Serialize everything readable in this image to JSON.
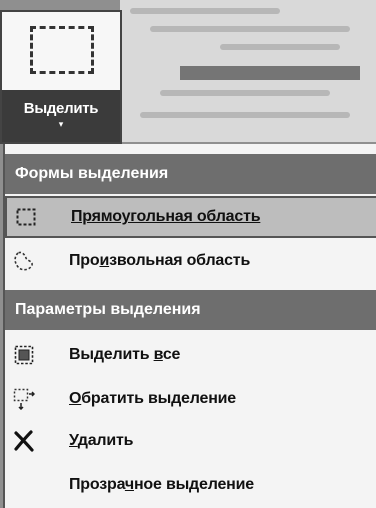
{
  "select_button": {
    "label": "Выделить",
    "arrow": "▾",
    "icon": "rectangle-select-icon"
  },
  "menu": {
    "section1": "Формы выделения",
    "section2": "Параметры выделения",
    "items": [
      {
        "icon": "rectangular-selection-icon",
        "before": "",
        "key": "",
        "after": "Прямоугольная область"
      },
      {
        "icon": "freeform-selection-icon",
        "before": "Про",
        "key": "и",
        "after": "звольная область"
      },
      {
        "icon": "select-all-icon",
        "before": "Выделить ",
        "key": "в",
        "after": "се"
      },
      {
        "icon": "invert-selection-icon",
        "before": "",
        "key": "О",
        "after": "братить выделение"
      },
      {
        "icon": "delete-icon",
        "before": "",
        "key": "У",
        "after": "далить"
      },
      {
        "icon": "transparent-selection-icon",
        "before": "Прозра",
        "key": "ч",
        "after": "ное выделение"
      }
    ]
  }
}
